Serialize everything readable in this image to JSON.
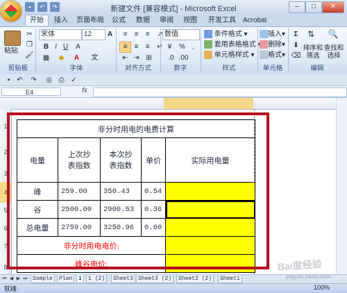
{
  "window": {
    "title": "新建文件 [兼容模式] - Microsoft Excel",
    "minimize": "–",
    "maximize": "□",
    "close": "✕"
  },
  "ribbon_tabs": [
    "开始",
    "插入",
    "页面布局",
    "公式",
    "数据",
    "审阅",
    "视图",
    "开发工具",
    "Acrobat"
  ],
  "clipboard": {
    "paste": "粘贴",
    "group": "剪贴板"
  },
  "font": {
    "name": "宋体",
    "size": "12",
    "bold": "B",
    "italic": "I",
    "underline": "U",
    "grow": "A",
    "shrink": "A",
    "wen": "文",
    "group": "字体"
  },
  "alignment": {
    "group": "对齐方式"
  },
  "number": {
    "format": "数值",
    "percent": "%",
    "comma": ",",
    "group": "数字"
  },
  "styles": {
    "conditional": "条件格式",
    "table": "套用表格格式",
    "cell": "单元格样式",
    "group": "样式"
  },
  "cells": {
    "insert": "插入",
    "delete": "删除",
    "format": "格式",
    "group": "单元格"
  },
  "editing": {
    "sigma": "Σ",
    "sort": "排序和\n筛选",
    "find": "查找和\n选择",
    "group": "编辑"
  },
  "formula_bar": {
    "cell_ref": "E4",
    "fx": "fx",
    "content": ""
  },
  "row_numbers": [
    "1",
    "2",
    "3",
    "4",
    "5",
    "6",
    "7",
    "8"
  ],
  "sheet": {
    "title": "非分时用电的电费计算",
    "headers": [
      "电量",
      "上次抄\n表指数",
      "本次抄\n表指数",
      "单价",
      "实际用电量"
    ],
    "rows": [
      {
        "label": "峰",
        "prev": "259.00",
        "curr": "350.43",
        "price": "0.54"
      },
      {
        "label": "谷",
        "prev": "2500.00",
        "curr": "2900.53",
        "price": "0.36"
      },
      {
        "label": "总电量",
        "prev": "2759.00",
        "curr": "3250.96",
        "price": "0.60"
      }
    ],
    "footer1": "非分时用电电价:",
    "footer2": "峰谷电价:",
    "highlight_color": "#ffff00",
    "label_color": "#ff0000"
  },
  "sheet_tabs": [
    "Sample",
    "Plan",
    "1",
    "1 (2)",
    "Sheet3",
    "Sheet3 (2)",
    "Sheet2 (2)",
    "Sheet1"
  ],
  "status": {
    "ready": "就绪",
    "zoom": "100%"
  },
  "watermark": {
    "text": "Bai度经验",
    "url": "jingyan.baidu.com"
  }
}
